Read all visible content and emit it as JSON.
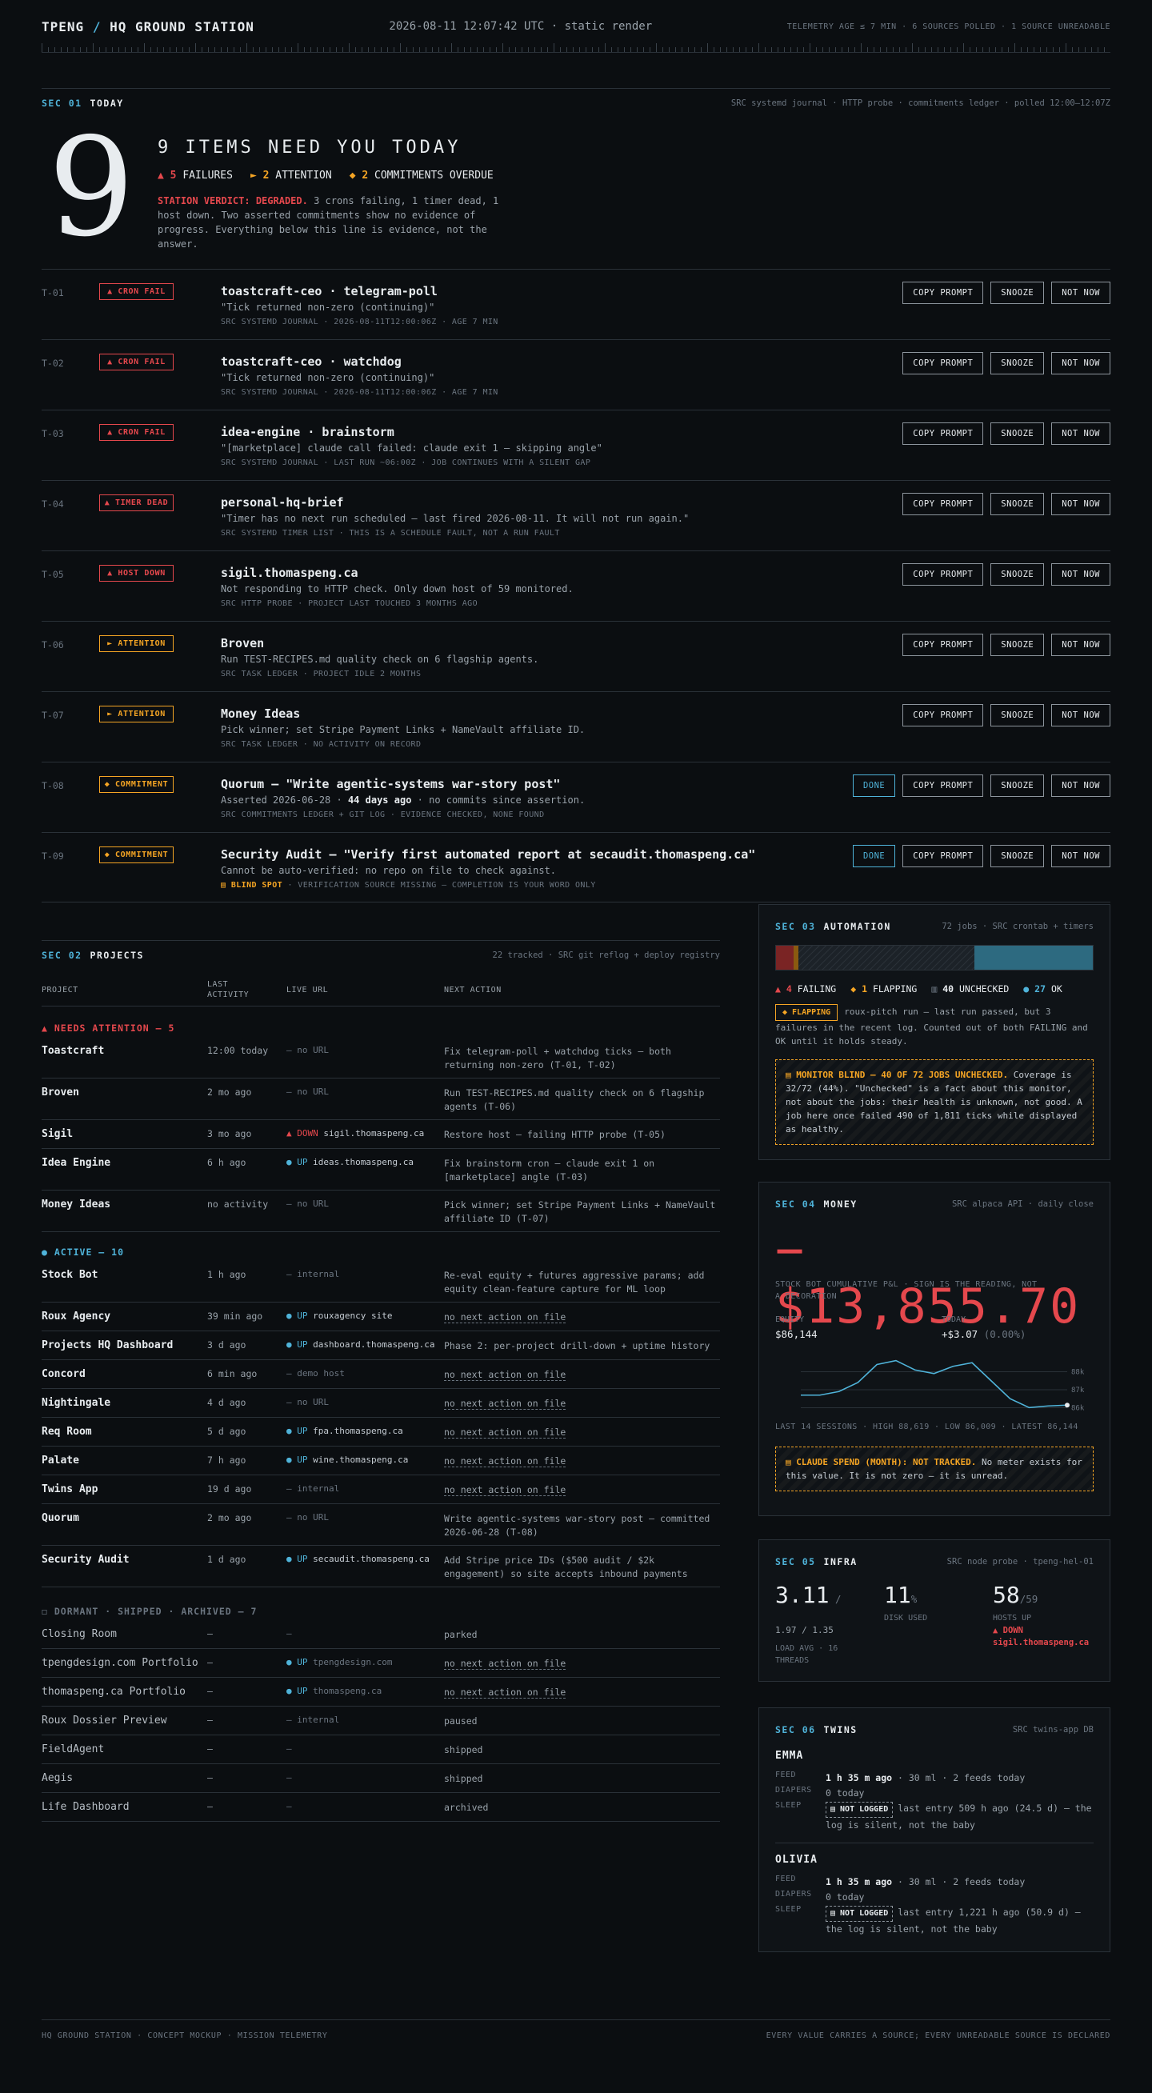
{
  "header": {
    "brand_a": "TPENG",
    "brand_sep": "/",
    "brand_b": "HQ GROUND STATION",
    "stamp": "2026-08-11 12:07:42 UTC · static render",
    "status": "TELEMETRY AGE ≤ 7 MIN · 6 SOURCES POLLED · 1 SOURCE UNREADABLE"
  },
  "today": {
    "num": "SEC 01",
    "title": "TODAY",
    "src": "SRC systemd journal · HTTP probe · commitments ledger · polled 12:00–12:07Z",
    "big": "9",
    "headline": "9 ITEMS NEED YOU TODAY",
    "c_fail_n": "5",
    "c_fail_l": "FAILURES",
    "c_att_n": "2",
    "c_att_l": "ATTENTION",
    "c_com_n": "2",
    "c_com_l": "COMMITMENTS OVERDUE",
    "verdict_lbl": "STATION VERDICT: DEGRADED.",
    "verdict": " 3 crons failing, 1 timer dead, 1 host down. Two asserted commitments show no evidence of progress. Everything below this line is evidence, not the answer."
  },
  "buttons": {
    "copy": "COPY PROMPT",
    "snooze": "SNOOZE",
    "notnow": "NOT NOW",
    "done": "DONE"
  },
  "items": [
    {
      "id": "T-01",
      "badge": "▲ CRON FAIL",
      "title": "toastcraft-ceo · telegram-poll",
      "desc": "\"Tick returned non-zero (continuing)\"",
      "meta": "SRC SYSTEMD JOURNAL · 2026-08-11T12:00:06Z · AGE 7 MIN"
    },
    {
      "id": "T-02",
      "badge": "▲ CRON FAIL",
      "title": "toastcraft-ceo · watchdog",
      "desc": "\"Tick returned non-zero (continuing)\"",
      "meta": "SRC SYSTEMD JOURNAL · 2026-08-11T12:00:06Z · AGE 7 MIN"
    },
    {
      "id": "T-03",
      "badge": "▲ CRON FAIL",
      "title": "idea-engine · brainstorm",
      "desc": "\"[marketplace] claude call failed: claude exit 1 — skipping angle\"",
      "meta": "SRC SYSTEMD JOURNAL · LAST RUN ~06:00Z · JOB CONTINUES WITH A SILENT GAP"
    },
    {
      "id": "T-04",
      "badge": "▲ TIMER DEAD",
      "title": "personal-hq-brief",
      "desc": "\"Timer has no next run scheduled — last fired 2026-08-11. It will not run again.\"",
      "meta": "SRC SYSTEMD TIMER LIST · THIS IS A SCHEDULE FAULT, NOT A RUN FAULT"
    },
    {
      "id": "T-05",
      "badge": "▲ HOST DOWN",
      "title": "sigil.thomaspeng.ca",
      "desc": "Not responding to HTTP check. Only down host of 59 monitored.",
      "meta": "SRC HTTP PROBE · PROJECT LAST TOUCHED 3 MONTHS AGO"
    },
    {
      "id": "T-06",
      "badge": "► ATTENTION",
      "title": "Broven",
      "desc": "Run TEST-RECIPES.md quality check on 6 flagship agents.",
      "meta": "SRC TASK LEDGER · PROJECT IDLE 2 MONTHS"
    },
    {
      "id": "T-07",
      "badge": "► ATTENTION",
      "title": "Money Ideas",
      "desc": "Pick winner; set Stripe Payment Links + NameVault affiliate ID.",
      "meta": "SRC TASK LEDGER · NO ACTIVITY ON RECORD"
    },
    {
      "id": "T-08",
      "badge": "◆ COMMITMENT",
      "title": "Quorum — \"Write agentic-systems war-story post\"",
      "desc_a": "Asserted 2026-06-28 · ",
      "desc_b": "44 days ago",
      "desc_c": " · no commits since assertion.",
      "meta": "SRC COMMITMENTS LEDGER + GIT LOG · EVIDENCE CHECKED, NONE FOUND"
    },
    {
      "id": "T-09",
      "badge": "◆ COMMITMENT",
      "title": "Security Audit — \"Verify first automated report at secaudit.thomaspeng.ca\"",
      "desc": "Cannot be auto-verified: no repo on file to check against.",
      "meta_a": "▤ BLIND SPOT",
      "meta_b": " · VERIFICATION SOURCE MISSING — COMPLETION IS YOUR WORD ONLY"
    }
  ],
  "projects": {
    "num": "SEC 02",
    "title": "PROJECTS",
    "src": "22 tracked · SRC git reflog + deploy registry",
    "cols": [
      "PROJECT",
      "LAST ACTIVITY",
      "LIVE URL",
      "NEXT ACTION"
    ],
    "g1": "▲ NEEDS ATTENTION — 5",
    "g2": "● ACTIVE — 10",
    "g3": "◻ DORMANT · SHIPPED · ARCHIVED — 7",
    "na": "no next action on file",
    "rows1": [
      [
        "Toastcraft",
        "12:00 today",
        "— no URL",
        "Fix telegram-poll + watchdog ticks — both returning non-zero (T-01, T-02)"
      ],
      [
        "Broven",
        "2 mo ago",
        "— no URL",
        "Run TEST-RECIPES.md quality check on 6 flagship agents (T-06)"
      ],
      [
        "Sigil",
        "3 mo ago",
        "sigil.thomaspeng.ca",
        "Restore host — failing HTTP probe (T-05)"
      ],
      [
        "Idea Engine",
        "6 h ago",
        "ideas.thomaspeng.ca",
        "Fix brainstorm cron — claude exit 1 on [marketplace] angle (T-03)"
      ],
      [
        "Money Ideas",
        "no activity",
        "— no URL",
        "Pick winner; set Stripe Payment Links + NameVault affiliate ID (T-07)"
      ]
    ],
    "rows2": [
      [
        "Stock Bot",
        "1 h ago",
        "— internal",
        "Re-eval equity + futures aggressive params; add equity clean-feature capture for ML loop"
      ],
      [
        "Roux Agency",
        "39 min ago",
        "rouxagency site",
        "no next action on file"
      ],
      [
        "Projects HQ Dashboard",
        "3 d ago",
        "dashboard.thomaspeng.ca",
        "Phase 2: per-project drill-down + uptime history"
      ],
      [
        "Concord",
        "6 min ago",
        "— demo host",
        "no next action on file"
      ],
      [
        "Nightingale",
        "4 d ago",
        "— no URL",
        "no next action on file"
      ],
      [
        "Req Room",
        "5 d ago",
        "fpa.thomaspeng.ca",
        "no next action on file"
      ],
      [
        "Palate",
        "7 h ago",
        "wine.thomaspeng.ca",
        "no next action on file"
      ],
      [
        "Twins App",
        "19 d ago",
        "— internal",
        "no next action on file"
      ],
      [
        "Quorum",
        "2 mo ago",
        "— no URL",
        "Write agentic-systems war-story post — committed 2026-06-28 (T-08)"
      ],
      [
        "Security Audit",
        "1 d ago",
        "secaudit.thomaspeng.ca",
        "Add Stripe price IDs ($500 audit / $2k engagement) so site accepts inbound payments"
      ]
    ],
    "rows3": [
      [
        "Closing Room",
        "—",
        "—",
        "parked"
      ],
      [
        "tpengdesign.com Portfolio",
        "—",
        "tpengdesign.com",
        "no next action on file"
      ],
      [
        "thomaspeng.ca Portfolio",
        "—",
        "thomaspeng.ca",
        "no next action on file"
      ],
      [
        "Roux Dossier Preview",
        "—",
        "— internal",
        "paused"
      ],
      [
        "FieldAgent",
        "—",
        "—",
        "shipped"
      ],
      [
        "Aegis",
        "—",
        "—",
        "shipped"
      ],
      [
        "Life Dashboard",
        "—",
        "—",
        "archived"
      ]
    ],
    "up": "UP",
    "down": "▲ DOWN"
  },
  "automation": {
    "num": "SEC 03",
    "title": "AUTOMATION",
    "src": "72 jobs · SRC crontab + timers",
    "l_fail_n": "4",
    "l_fail": "FAILING",
    "l_flap_n": "1",
    "l_flap": "FLAPPING",
    "l_unc_n": "40",
    "l_unc": "UNCHECKED",
    "l_ok_n": "27",
    "l_ok": "OK",
    "flap_badge": "◆ FLAPPING",
    "flap_text": "roux-pitch run — last run passed, but 3 failures in the recent log. Counted out of both FAILING and OK until it holds steady.",
    "blind_h": "▤ MONITOR BLIND — 40 OF 72 JOBS UNCHECKED.",
    "blind": " Coverage is 32/72 (44%). \"Unchecked\" is a fact about this monitor, not about the jobs: their health is unknown, not good. A job here once failed 490 of 1,811 ticks while displayed as healthy.",
    "counts": {
      "failing": 4,
      "flapping": 1,
      "unchecked": 40,
      "ok": 27
    },
    "colors": {
      "failing": "#7a2424",
      "flapping": "#8a5a10",
      "unchecked": "#1c2228",
      "ok": "#2d6a80"
    }
  },
  "money": {
    "num": "SEC 04",
    "title": "MONEY",
    "src": "SRC alpaca API · daily close",
    "big": "−$13,855.70",
    "sub": "STOCK BOT CUMULATIVE P&L · SIGN IS THE READING, NOT A DECORATION",
    "eq_l": "EQUITY",
    "eq_v": "$86,144",
    "td_l": "TODAY",
    "td_v": "+$3.07",
    "td_p": "(0.00%)",
    "stats": "LAST 14 SESSIONS · HIGH 88,619 · LOW 86,009 · LATEST 86,144",
    "spend_h": "▤ CLAUDE SPEND (MONTH): NOT TRACKED.",
    "spend": " No meter exists for this value. It is not zero — it is unread."
  },
  "chart_data": {
    "type": "line",
    "series": [
      {
        "values": [
          86700,
          86700,
          86900,
          87400,
          88400,
          88619,
          88100,
          87900,
          88300,
          88500,
          87500,
          86500,
          86009,
          86100,
          86144
        ]
      }
    ],
    "ytick_labels": [
      "88k",
      "87k",
      "86k"
    ],
    "yticks": [
      88000,
      87000,
      86000
    ],
    "ylim": [
      85800,
      89000
    ]
  },
  "infra": {
    "num": "SEC 05",
    "title": "INFRA",
    "src": "SRC node probe · tpeng-hel-01",
    "load": "3.11",
    "load_sep": "/",
    "load_sub": "1.97 / 1.35",
    "load_l": "LOAD AVG · 16 THREADS",
    "disk": "11",
    "disk_u": "%",
    "disk_l": "DISK USED",
    "hosts": "58",
    "hosts_of": "/59",
    "hosts_l": "HOSTS UP",
    "hosts_dn": "▲ DOWN",
    "hosts_dn_h": "sigil.thomaspeng.ca"
  },
  "twins": {
    "num": "SEC 06",
    "title": "TWINS",
    "src": "SRC twins-app DB",
    "k_feed": "FEED",
    "k_diap": "DIAPERS",
    "k_sleep": "SLEEP",
    "nl": "▤ NOT LOGGED",
    "emma": {
      "name": "EMMA",
      "feed_b": "1 h 35 m ago",
      "feed": " · 30 ml · 2 feeds today",
      "diap": "0 today",
      "sleep": "last entry 509 h ago (24.5 d) — the log is silent, not the baby"
    },
    "olivia": {
      "name": "OLIVIA",
      "feed_b": "1 h 35 m ago",
      "feed": " · 30 ml · 2 feeds today",
      "diap": "0 today",
      "sleep": "last entry 1,221 h ago (50.9 d) — the log is silent, not the baby"
    }
  },
  "footer": {
    "left": "HQ GROUND STATION · CONCEPT MOCKUP · MISSION TELEMETRY",
    "right": "EVERY VALUE CARRIES A SOURCE; EVERY UNREADABLE SOURCE IS DECLARED"
  }
}
